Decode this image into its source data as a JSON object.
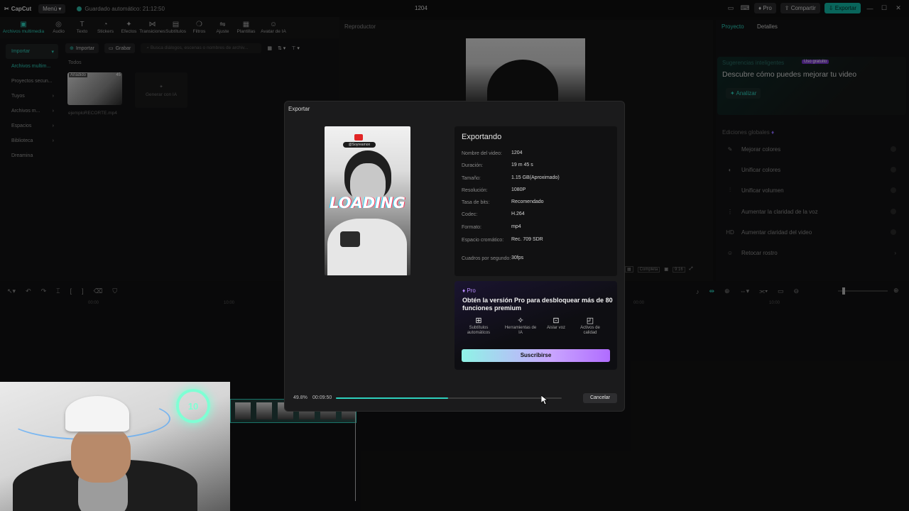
{
  "titlebar": {
    "app_name": "CapCut",
    "menu_label": "Menú",
    "autosave_text": "Guardado automático: 21:12:50",
    "project_name": "1204",
    "pro_label": "Pro",
    "share_label": "Compartir",
    "export_label": "Exportar"
  },
  "toolbar": {
    "items": [
      {
        "label": "Archivos multimedia",
        "icon": "media-icon"
      },
      {
        "label": "Audio",
        "icon": "audio-icon"
      },
      {
        "label": "Texto",
        "icon": "text-icon"
      },
      {
        "label": "Stickers",
        "icon": "sticker-icon"
      },
      {
        "label": "Efectos",
        "icon": "effects-icon"
      },
      {
        "label": "Transiciones",
        "icon": "transitions-icon"
      },
      {
        "label": "Subtítulos",
        "icon": "subtitles-icon"
      },
      {
        "label": "Filtros",
        "icon": "filters-icon"
      },
      {
        "label": "Ajuste",
        "icon": "adjust-icon"
      },
      {
        "label": "Plantillas",
        "icon": "templates-icon"
      },
      {
        "label": "Avatar de IA",
        "icon": "avatar-icon"
      }
    ]
  },
  "sidenav": {
    "items": [
      "Importar",
      "Archivos multim...",
      "Proyectos secun...",
      "Tuyos",
      "Archivos m...",
      "Espacios",
      "Biblioteca",
      "Dreamina"
    ]
  },
  "media": {
    "import_label": "Importar",
    "record_label": "Grabar",
    "search_placeholder": "Busca diálogos, escenas o nombres de archiv...",
    "section_label": "Todos",
    "clip_badge": "Añadido",
    "clip_duration": "45",
    "clip_name": "ejemploRECORTE.mp4",
    "generate_label": "Generar con IA"
  },
  "player": {
    "title": "Reproductor",
    "ctrl_full": "Completa",
    "ctrl_ratio": "9:16"
  },
  "rightpanel": {
    "tab_project": "Proyecto",
    "tab_details": "Detalles",
    "suggestions_label": "Sugerencias inteligentes",
    "free_badge": "Uso gratuito",
    "suggestions_title": "Descubre cómo puedes mejorar tu video",
    "analyze_label": "Analizar",
    "global_label": "Ediciones globales",
    "global_items": [
      "Mejorar colores",
      "Unificar colores",
      "Unificar volumen",
      "Aumentar la claridad de la voz",
      "Aumentar claridad del video",
      "Retocar rostro"
    ]
  },
  "timeline": {
    "ruler": [
      "00:00",
      "10:00",
      "00:00",
      "10:00"
    ]
  },
  "export_dialog": {
    "title": "Exportar",
    "status_title": "Exportando",
    "preview_pill": "@Soyreamon",
    "preview_overlay": "LOADING",
    "rows": [
      {
        "k": "Nombre del video:",
        "v": "1204"
      },
      {
        "k": "Duración:",
        "v": "19 m 45 s"
      },
      {
        "k": "Tamaño:",
        "v": "1.15 GB(Aproximado)"
      },
      {
        "k": "Resolución:",
        "v": "1080P"
      },
      {
        "k": "Tasa de bits:",
        "v": "Recomendado"
      },
      {
        "k": "Codec:",
        "v": "H.264"
      },
      {
        "k": "Formato:",
        "v": "mp4"
      },
      {
        "k": "Espacio cromático:",
        "v": "Rec. 709 SDR"
      },
      {
        "k": "Cuadros por segundo:",
        "v": "30fps"
      }
    ],
    "pro_tag": "Pro",
    "pro_text": "Obtén la versión Pro para desbloquear más de 80 funciones premium",
    "features": [
      {
        "label": "Subtítulos automáticos",
        "icon": "grid-icon"
      },
      {
        "label": "Herramientas de IA",
        "icon": "magic-wand-icon"
      },
      {
        "label": "Aislar voz",
        "icon": "voice-icon"
      },
      {
        "label": "Activos de calidad",
        "icon": "assets-icon"
      }
    ],
    "subscribe_label": "Suscribirse",
    "progress_pct_text": "49.8%",
    "progress_value": 0.498,
    "elapsed_text": "00:09:50",
    "cancel_label": "Cancelar"
  },
  "colors": {
    "accent": "#2ed1bd",
    "pro_purple": "#b98cff"
  }
}
